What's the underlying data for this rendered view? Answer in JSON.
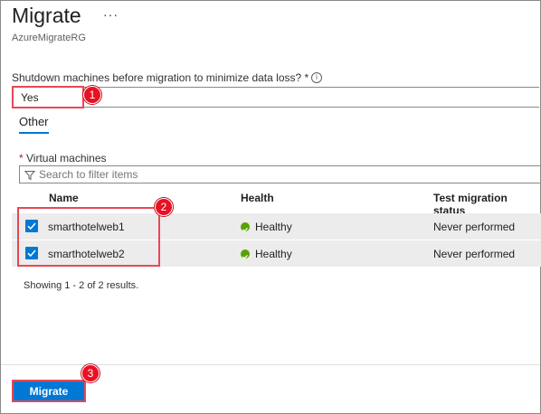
{
  "header": {
    "title": "Migrate",
    "more_label": "···",
    "subtitle": "AzureMigrateRG"
  },
  "shutdown": {
    "label": "Shutdown machines before migration to minimize data loss? *",
    "info_icon": "info-icon",
    "value": "Yes"
  },
  "tabs": [
    {
      "label": "Other",
      "active": true
    }
  ],
  "vms": {
    "required_mark": "*",
    "label": "Virtual machines",
    "filter_placeholder": "Search to filter items",
    "filter_icon": "funnel-icon",
    "columns": [
      "Name",
      "Health",
      "Test migration status"
    ],
    "rows": [
      {
        "name": "smarthotelweb1",
        "health": "Healthy",
        "test_status": "Never performed",
        "selected": true
      },
      {
        "name": "smarthotelweb2",
        "health": "Healthy",
        "test_status": "Never performed",
        "selected": true
      }
    ],
    "results_text": "Showing 1 - 2 of 2 results."
  },
  "callouts": [
    "1",
    "2",
    "3"
  ],
  "footer": {
    "migrate_label": "Migrate"
  },
  "colors": {
    "accent": "#0078d4",
    "callout": "#e81123",
    "healthy": "#57a300",
    "row_background": "#ececec"
  }
}
